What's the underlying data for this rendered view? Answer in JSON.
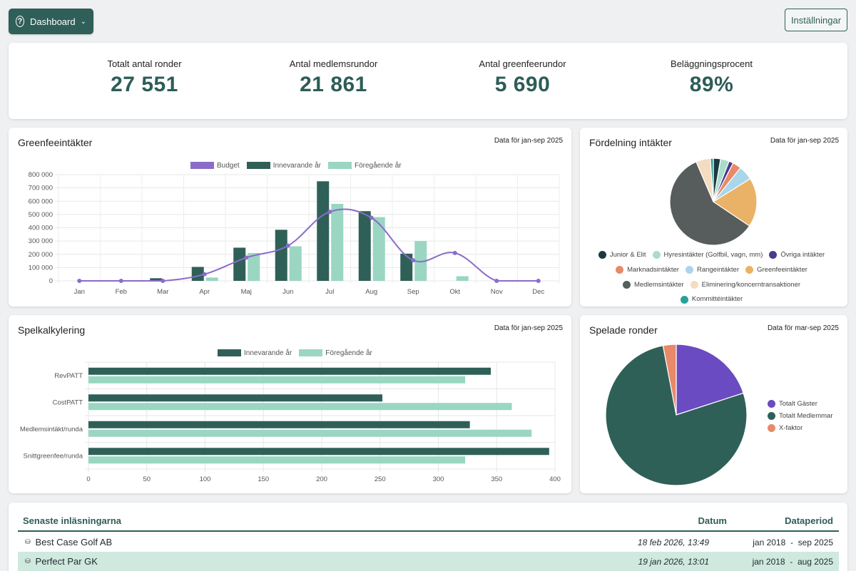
{
  "header": {
    "dashboard_label": "Dashboard",
    "help_icon": "question-circle-icon",
    "settings_label": "Inställningar"
  },
  "kpis": [
    {
      "label": "Totalt antal ronder",
      "value": "27 551"
    },
    {
      "label": "Antal medlemsrundor",
      "value": "21 861"
    },
    {
      "label": "Antal greenfeerundor",
      "value": "5 690"
    },
    {
      "label": "Beläggningsprocent",
      "value": "89%"
    }
  ],
  "greenfee": {
    "title": "Greenfeeintäkter",
    "subtitle": "Data för jan-sep 2025",
    "chart_data": {
      "type": "bar",
      "categories": [
        "Jan",
        "Feb",
        "Mar",
        "Apr",
        "Maj",
        "Jun",
        "Jul",
        "Aug",
        "Sep",
        "Okt",
        "Nov",
        "Dec"
      ],
      "series": [
        {
          "name": "Budget",
          "type": "line",
          "color": "#8a6cc9",
          "values": [
            0,
            0,
            0,
            50000,
            175000,
            265000,
            520000,
            475000,
            155000,
            210000,
            0,
            0
          ]
        },
        {
          "name": "Innevarande år",
          "color": "#2f6058",
          "values": [
            0,
            0,
            20000,
            105000,
            250000,
            385000,
            750000,
            525000,
            205000,
            0,
            0,
            0
          ]
        },
        {
          "name": "Föregående år",
          "color": "#9ad6c2",
          "values": [
            0,
            0,
            0,
            25000,
            210000,
            260000,
            580000,
            480000,
            300000,
            35000,
            0,
            0
          ]
        }
      ],
      "ylim": [
        0,
        800000
      ],
      "yticks": [
        "0",
        "100 000",
        "200 000",
        "300 000",
        "400 000",
        "500 000",
        "600 000",
        "700 000",
        "800 000"
      ],
      "legend": "top"
    }
  },
  "fordelning": {
    "title": "Fördelning intäkter",
    "subtitle": "Data för jan-sep 2025",
    "chart_data": {
      "type": "pie",
      "labels": [
        "Junior & Elit",
        "Hyresintäkter (Golfbil, vagn, mm)",
        "Övriga intäkter",
        "Marknadsintäkter",
        "Rangeintäkter",
        "Greenfeeintäkter",
        "Medlemsintäkter",
        "Eliminering/koncerntransaktioner",
        "Kommittéintäkter"
      ],
      "values": [
        2.5,
        3,
        1.5,
        3,
        5,
        17,
        55,
        5,
        1
      ],
      "colors": [
        "#1b3a40",
        "#a9dccb",
        "#4a3a8c",
        "#e8896a",
        "#a9d6ea",
        "#e9b266",
        "#565d5c",
        "#f4dcc0",
        "#2aa198"
      ]
    }
  },
  "spelkalkylering": {
    "title": "Spelkalkylering",
    "subtitle": "Data för jan-sep 2025",
    "chart_data": {
      "type": "bar",
      "orientation": "horizontal",
      "categories": [
        "RevPATT",
        "CostPATT",
        "Medlemsintäkt/runda",
        "Snittgreenfee/runda"
      ],
      "series": [
        {
          "name": "Innevarande år",
          "color": "#2f6058",
          "values": [
            345,
            252,
            327,
            395
          ]
        },
        {
          "name": "Föregående år",
          "color": "#9ad6c2",
          "values": [
            323,
            363,
            380,
            323
          ]
        }
      ],
      "xlim": [
        0,
        400
      ],
      "xticks": [
        "0",
        "50",
        "100",
        "150",
        "200",
        "250",
        "300",
        "350",
        "400"
      ],
      "legend": "top"
    }
  },
  "spelade": {
    "title": "Spelade ronder",
    "subtitle": "Data för mar-sep 2025",
    "chart_data": {
      "type": "pie",
      "labels": [
        "Totalt Gäster",
        "Totalt Medlemmar",
        "X-faktor"
      ],
      "values": [
        20,
        77,
        3
      ],
      "colors": [
        "#6a4bc2",
        "#2f6058",
        "#e8896a"
      ]
    }
  },
  "table": {
    "headers": {
      "name": "Senaste inläsningarna",
      "date": "Datum",
      "period": "Dataperiod"
    },
    "rows": [
      {
        "name": "Best Case Golf AB",
        "date": "18 feb 2026, 13:49",
        "period": "jan 2018  -  sep 2025"
      },
      {
        "name": "Perfect Par GK",
        "date": "19 jan 2026, 13:01",
        "period": "jan 2018  -  aug 2025"
      }
    ]
  }
}
